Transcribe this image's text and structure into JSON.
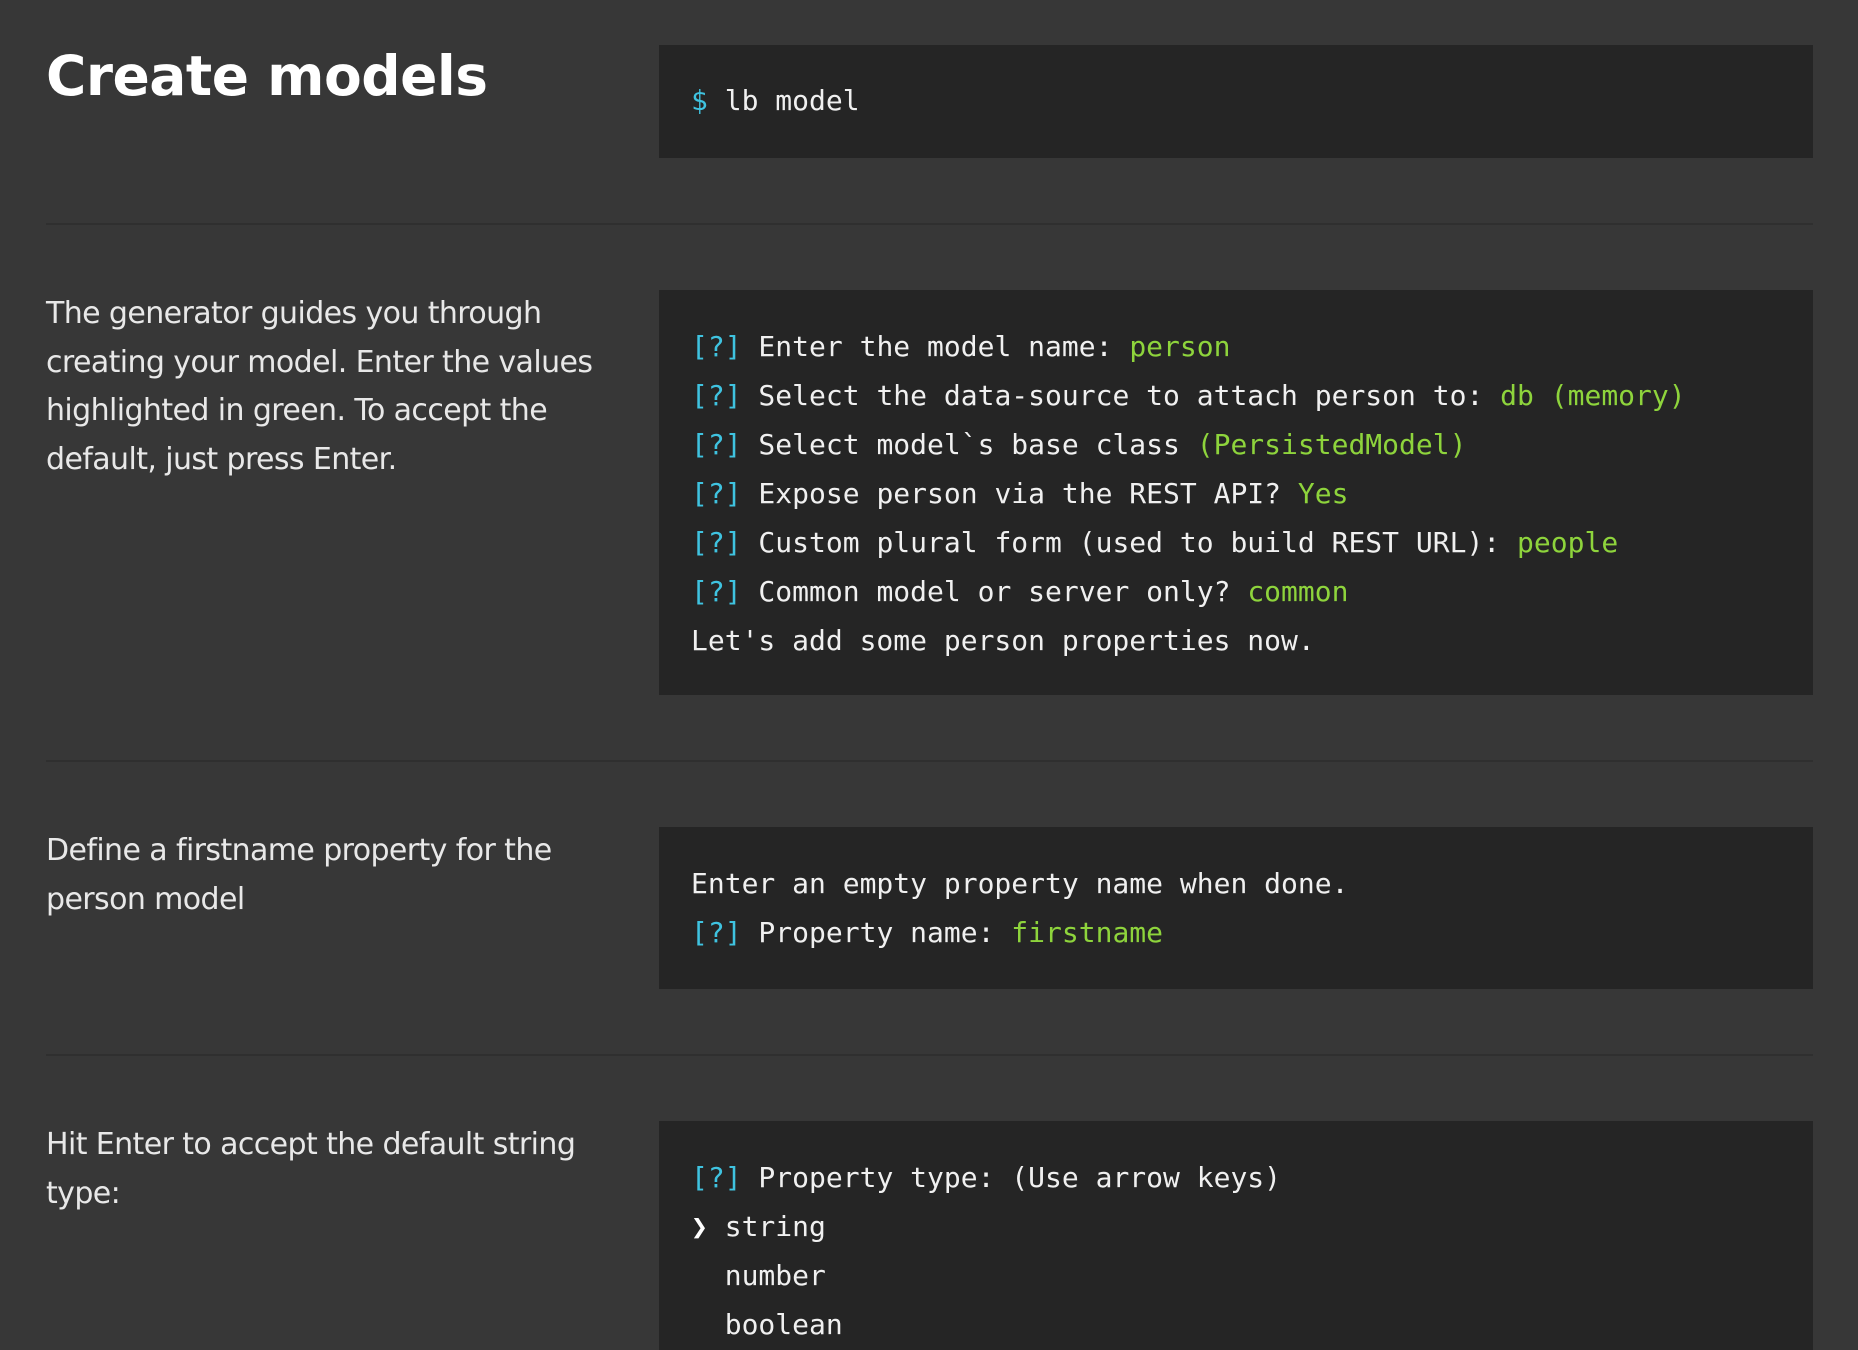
{
  "header": {
    "title": "Create models",
    "command": {
      "prompt": "$",
      "text": "lb model"
    }
  },
  "sections": [
    {
      "description": [
        "The generator guides you through",
        "creating your model. Enter the values",
        "highlighted in green. To accept the",
        "default, just press Enter."
      ],
      "lines": [
        {
          "prefix": "[?]",
          "text": " Enter the model name: ",
          "answer": "person"
        },
        {
          "prefix": "[?]",
          "text": " Select the data-source to attach person to: ",
          "answer": "db (memory)"
        },
        {
          "prefix": "[?]",
          "text": " Select model`s base class ",
          "answer": "(PersistedModel)"
        },
        {
          "prefix": "[?]",
          "text": " Expose person via the REST API? ",
          "answer": "Yes"
        },
        {
          "prefix": "[?]",
          "text": " Custom plural form (used to build REST URL): ",
          "answer": "people"
        },
        {
          "prefix": "[?]",
          "text": " Common model or server only? ",
          "answer": "common"
        },
        {
          "prefix": "",
          "text": "Let's add some person properties now.",
          "answer": ""
        }
      ]
    },
    {
      "description": [
        "Define a firstname property for the",
        "person model"
      ],
      "lines": [
        {
          "prefix": "",
          "text": "Enter an empty property name when done.",
          "answer": ""
        },
        {
          "prefix": "[?]",
          "text": " Property name: ",
          "answer": "firstname"
        }
      ]
    },
    {
      "description": [
        "Hit Enter to accept the default string",
        "type:"
      ],
      "lines": [
        {
          "prefix": "[?]",
          "text": " Property type: (Use arrow keys)",
          "answer": ""
        },
        {
          "pointer": "❯",
          "text": " string"
        },
        {
          "pointer": " ",
          "text": " number"
        },
        {
          "pointer": " ",
          "text": " boolean"
        }
      ]
    }
  ]
}
